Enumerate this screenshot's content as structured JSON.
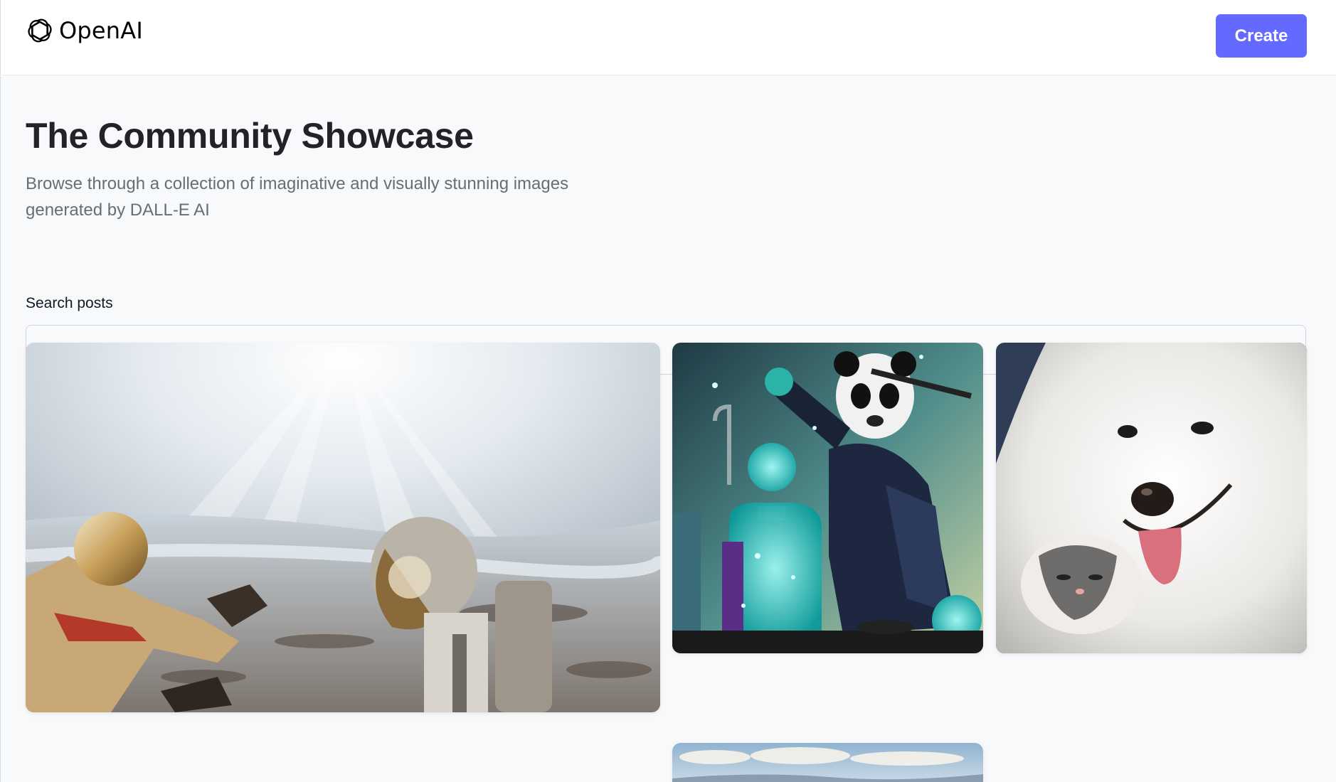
{
  "header": {
    "logo_text": "OpenAI",
    "logo_icon": "openai-logo-icon",
    "create_label": "Create"
  },
  "hero": {
    "title": "The Community Showcase",
    "subtitle": "Browse through a collection of imaginative and visually stunning images generated by DALL-E AI"
  },
  "search": {
    "label": "Search posts",
    "placeholder": "Search posts",
    "value": ""
  },
  "gallery": {
    "cards": [
      {
        "image": "astronauts-on-moon-image"
      },
      {
        "image": "panda-scientist-image"
      },
      {
        "image": "samoyed-dog-and-kitten-image"
      },
      {
        "image": "landscape-sky-image"
      }
    ]
  },
  "colors": {
    "accent": "#6469ff",
    "background": "#f8f9fb",
    "title": "#222328",
    "subtitle": "#666e75"
  }
}
